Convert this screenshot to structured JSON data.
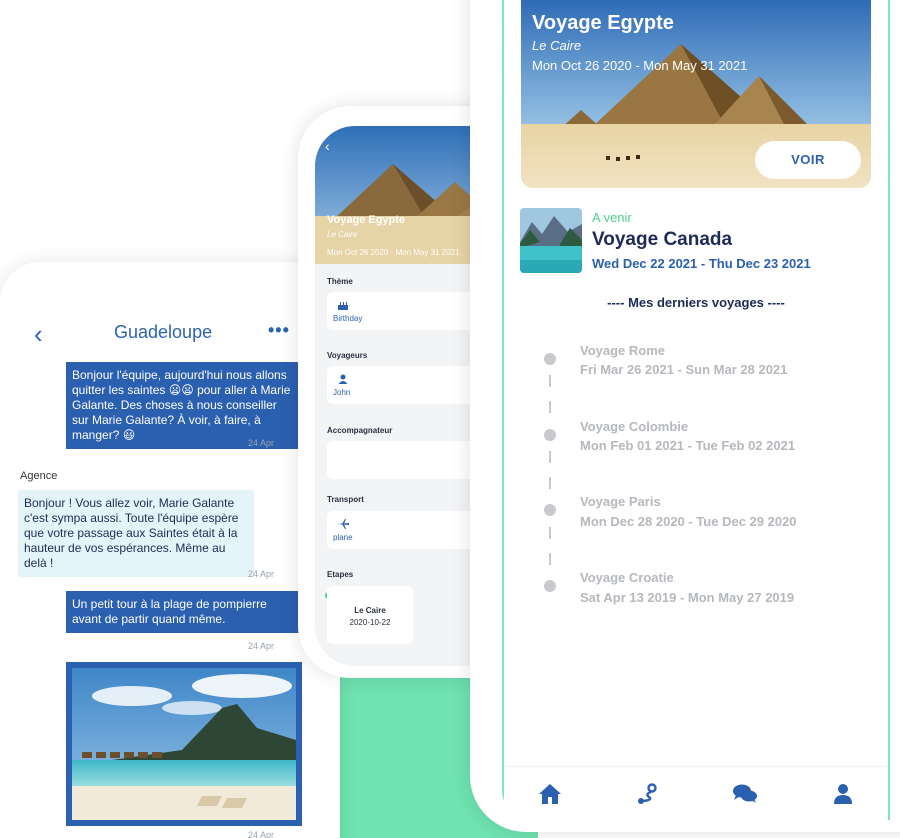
{
  "colors": {
    "primary": "#2b5fb0",
    "navy": "#1e2b57",
    "accent_green": "#4fd08f",
    "mint": "#6fe3b0",
    "incoming_bubble": "#e4f4f8",
    "muted": "#b5b8bc"
  },
  "chat": {
    "title": "Guadeloupe",
    "back_icon": "chevron-left-icon",
    "more_icon": "more-dots-icon",
    "more_label": "•••",
    "sender_label": "Agence",
    "messages": [
      {
        "from": "me",
        "text": "Bonjour l'équipe, aujourd'hui nous allons quitter les saintes 😦😦 pour aller à Marie Galante. Des choses à nous conseiller sur Marie Galante? À voir, à faire, à manger? 😃",
        "time": "24 Apr"
      },
      {
        "from": "agence",
        "text": "Bonjour ! Vous allez voir, Marie Galante c'est sympa aussi. Toute l'équipe espère que votre passage aux Saintes était à la hauteur de vos espérances. Même au delà !",
        "time": "24 Apr"
      },
      {
        "from": "me",
        "text": "Un petit tour à la plage de pompierre avant de partir quand même.",
        "time": "24 Apr"
      },
      {
        "from": "me",
        "type": "image",
        "time": "24 Apr"
      }
    ]
  },
  "trip_detail": {
    "title": "Voyage Egypte",
    "city": "Le Caire",
    "dates": "Mon Oct 26 2020 - Mon May 31 2021",
    "sections": {
      "theme_label": "Thème",
      "theme_value": "Birthday",
      "travelers_label": "Voyageurs",
      "travelers_value": "John",
      "companion_label": "Accompagnateur",
      "transport_label": "Transport",
      "transport_value": "plane",
      "steps_label": "Etapes",
      "step_city": "Le Caire",
      "step_date": "2020-10-22"
    }
  },
  "trips": {
    "featured": {
      "title": "Voyage Egypte",
      "city": "Le Caire",
      "dates": "Mon Oct 26 2020 - Mon May 31 2021",
      "button_label": "VOIR"
    },
    "upcoming": {
      "status": "A venir",
      "name": "Voyage Canada",
      "dates": "Wed Dec 22 2021 - Thu Dec 23 2021"
    },
    "history_title": "---- Mes derniers voyages ----",
    "history": [
      {
        "name": "Voyage Rome",
        "dates": "Fri Mar 26 2021 - Sun Mar 28 2021"
      },
      {
        "name": "Voyage Colombie",
        "dates": "Mon Feb 01 2021 - Tue Feb 02 2021"
      },
      {
        "name": "Voyage Paris",
        "dates": "Mon Dec 28 2020 - Tue Dec 29 2020"
      },
      {
        "name": "Voyage Croatie",
        "dates": "Sat Apr 13 2019 - Mon May 27 2019"
      }
    ]
  },
  "nav": {
    "items": [
      {
        "icon": "home-icon"
      },
      {
        "icon": "route-icon"
      },
      {
        "icon": "chat-icon"
      },
      {
        "icon": "user-icon"
      }
    ]
  }
}
